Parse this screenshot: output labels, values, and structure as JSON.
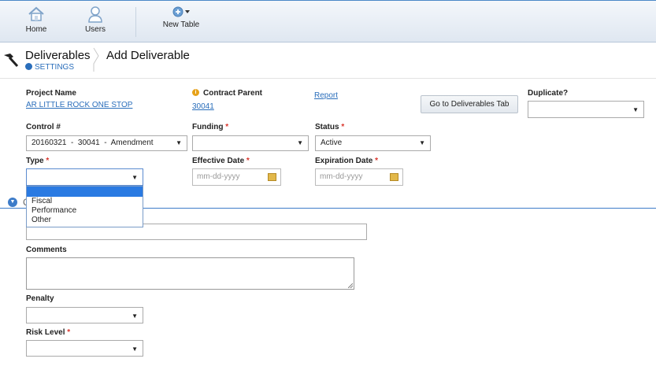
{
  "toolbar": {
    "home_label": "Home",
    "users_label": "Users",
    "new_table_label": "New Table"
  },
  "breadcrumb": {
    "title": "Deliverables",
    "current": "Add Deliverable",
    "settings_label": "SETTINGS"
  },
  "form": {
    "project_name": {
      "label": "Project Name",
      "value": "AR LITTLE ROCK ONE STOP"
    },
    "contract_parent": {
      "label": "Contract Parent",
      "value": "30041"
    },
    "report_link": "Report",
    "go_button": "Go to Deliverables Tab",
    "duplicate": {
      "label": "Duplicate?",
      "value": ""
    },
    "control": {
      "label": "Control #",
      "value": "20160321  -  30041  -  Amendment"
    },
    "funding": {
      "label": "Funding",
      "required": "*",
      "value": ""
    },
    "status": {
      "label": "Status",
      "required": "*",
      "value": "Active"
    },
    "type": {
      "label": "Type",
      "required": "*",
      "value": "",
      "options": [
        "",
        "Fiscal",
        "Performance",
        "Other"
      ]
    },
    "effective_date": {
      "label": "Effective Date",
      "required": "*",
      "placeholder": "mm-dd-yyyy"
    },
    "expiration_date": {
      "label": "Expiration Date",
      "required": "*",
      "placeholder": "mm-dd-yyyy"
    },
    "section_letter": "C",
    "comments": {
      "label": "Comments"
    },
    "penalty": {
      "label": "Penalty",
      "value": ""
    },
    "risk_level": {
      "label": "Risk Level",
      "required": "*",
      "value": ""
    }
  },
  "colors": {
    "accent": "#2a6ebb",
    "required": "#d9342b",
    "selected": "#2a7ae2"
  }
}
